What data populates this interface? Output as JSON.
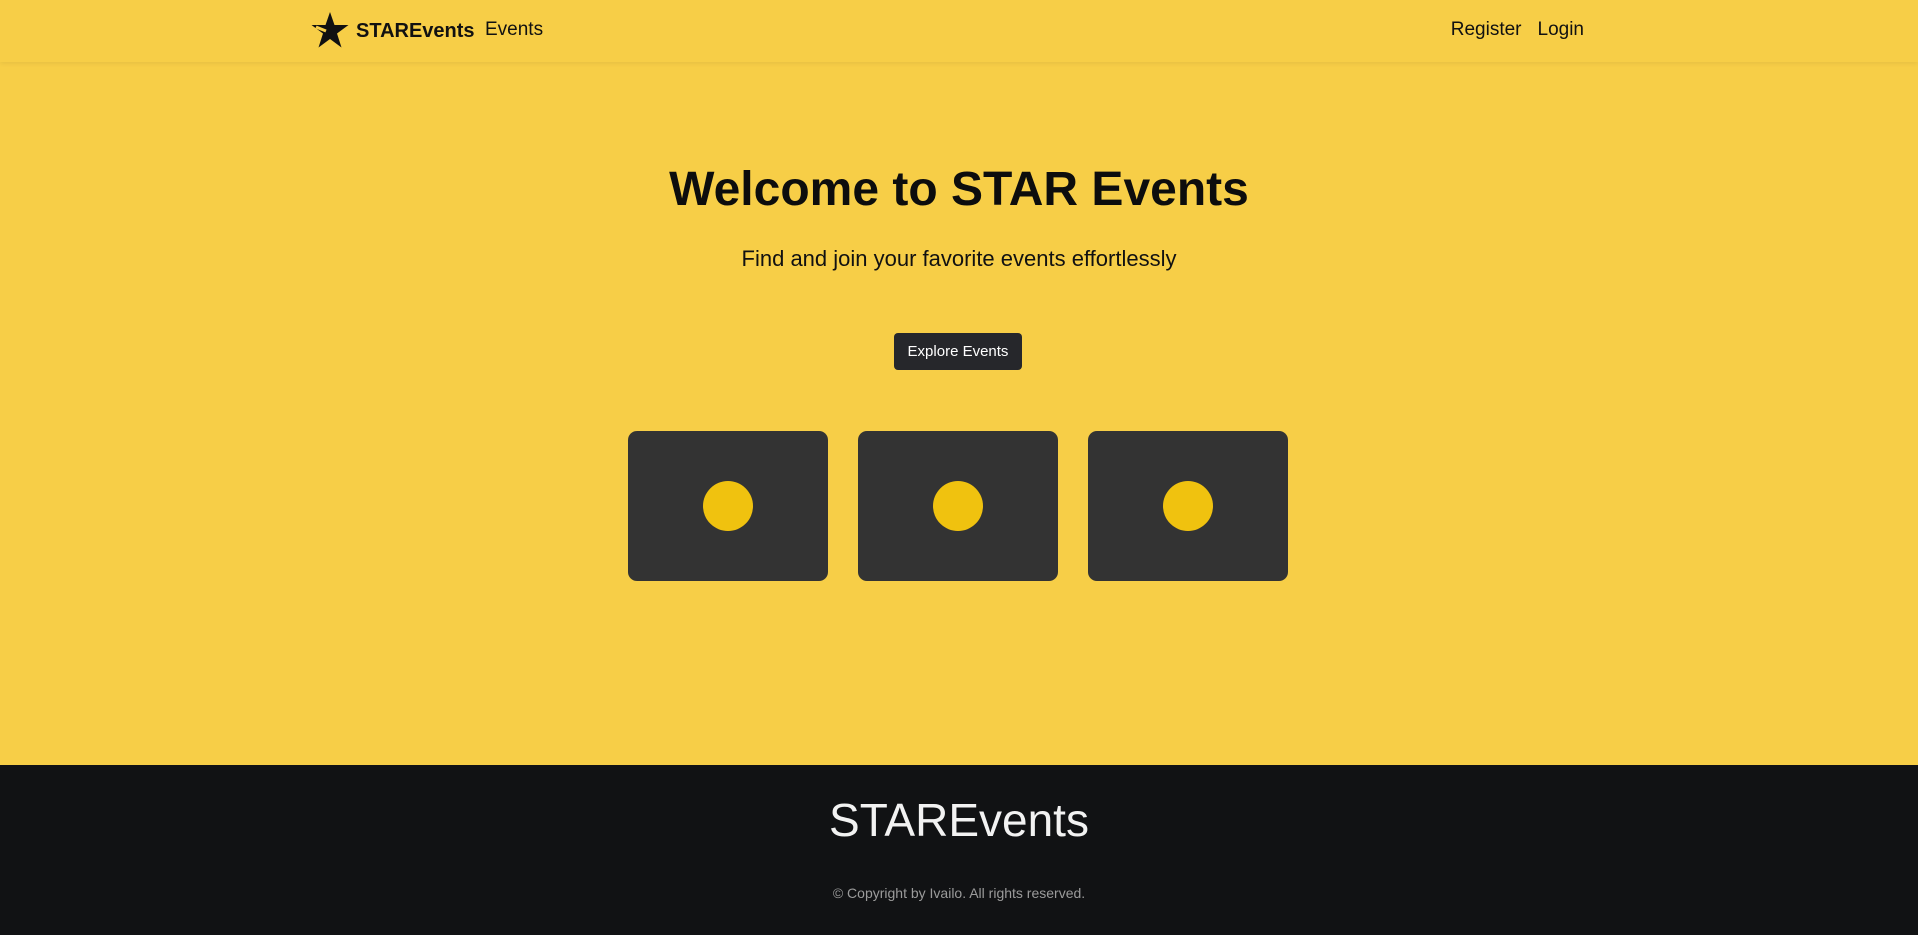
{
  "nav": {
    "brand": "STAREvents",
    "brand_icon": "star-logo-icon",
    "events_link": "Events",
    "register_link": "Register",
    "login_link": "Login"
  },
  "hero": {
    "title": "Welcome to STAR Events",
    "subtitle": "Find and join your favorite events effortlessly",
    "cta_label": "Explore Events"
  },
  "cards": [
    {
      "icon": "circle-placeholder-icon"
    },
    {
      "icon": "circle-placeholder-icon"
    },
    {
      "icon": "circle-placeholder-icon"
    }
  ],
  "footer": {
    "brand": "STAREvents",
    "copyright": "© Copyright by Ivailo. All rights reserved."
  },
  "colors": {
    "background": "#f7ce47",
    "card": "#333333",
    "accent": "#f0c20f",
    "button": "#26272b",
    "footer": "#111214"
  }
}
